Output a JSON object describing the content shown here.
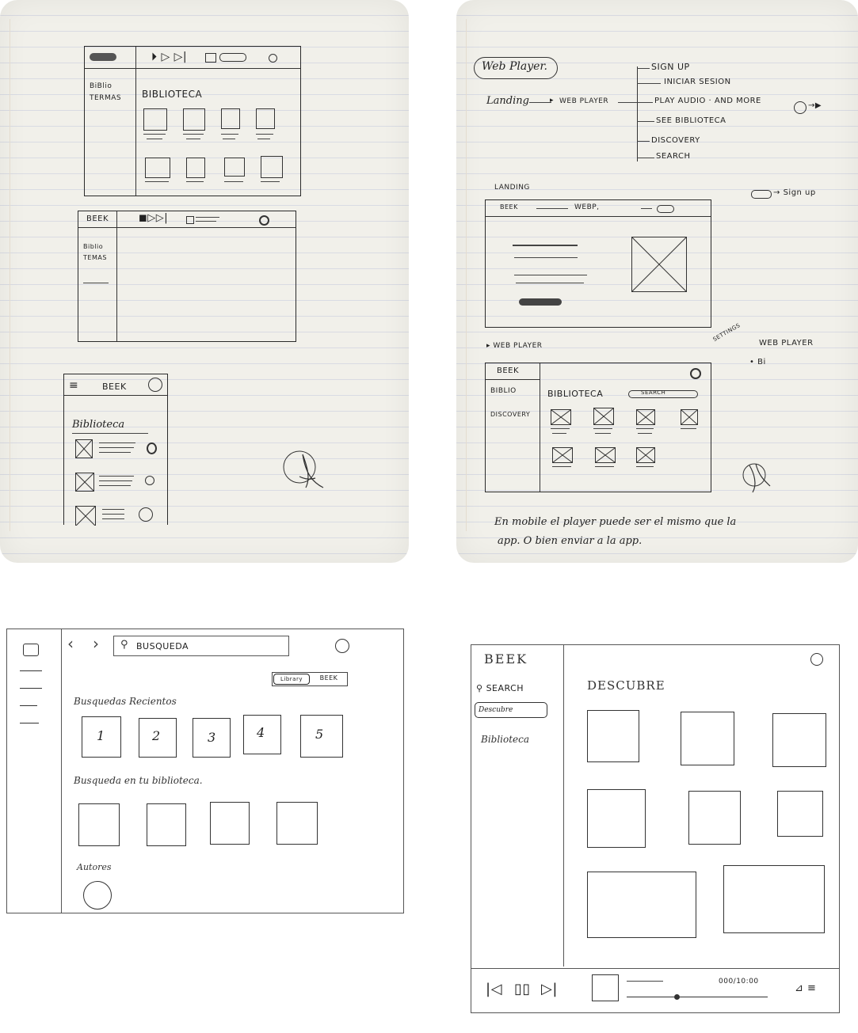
{
  "sketch_left": {
    "sketch1": {
      "sidebar_items": [
        "BiBlio",
        "TERMAS"
      ],
      "heading": "BIBLIOTECA"
    },
    "sketch2": {
      "logo": "BEEK",
      "sidebar_items": [
        "Biblio",
        "TEMAS"
      ]
    },
    "sketch3": {
      "logo": "BEEK",
      "heading": "Biblioteca"
    }
  },
  "sketch_right": {
    "flow": {
      "title": "Web Player.",
      "start": "Landing",
      "middle": "WEB PLAYER",
      "branches": [
        "SIGN UP",
        "INICIAR SESION",
        "PLAY AUDIO · AND MORE",
        "SEE BIBLIOTECA",
        "DISCOVERY",
        "SEARCH"
      ]
    },
    "landing": {
      "label": "LANDING",
      "nav_logo": "BEEK",
      "nav_text": "WEBP,",
      "signup_note": "Sign up"
    },
    "webplayer": {
      "arrow_label": "WEB PLAYER",
      "settings_label": "SETTINGS",
      "side_note_title": "WEB PLAYER",
      "side_note_item": "• Bi",
      "logo": "BEEK",
      "sidebar_items": [
        "BIBLIO",
        "DISCOVERY"
      ],
      "heading": "BIBLIOTECA",
      "search": "SEARCH"
    },
    "note_line1": "En mobile el player puede ser el mismo que la",
    "note_line2": "app. O bien enviar a la app."
  },
  "wireframe_search": {
    "search_placeholder": "BUSQUEDA",
    "toggle": [
      "Library",
      "BEEK"
    ],
    "recent_heading": "Busquedas Recientos",
    "recent_items": [
      "1",
      "2",
      "3",
      "4",
      "5"
    ],
    "library_heading": "Busqueda en tu biblioteca.",
    "authors_heading": "Autores"
  },
  "wireframe_discover": {
    "logo": "BEEK",
    "nav_items": [
      "SEARCH",
      "Descubre",
      "Biblioteca"
    ],
    "heading": "DESCUBRE",
    "player_time": "000/10:00"
  }
}
